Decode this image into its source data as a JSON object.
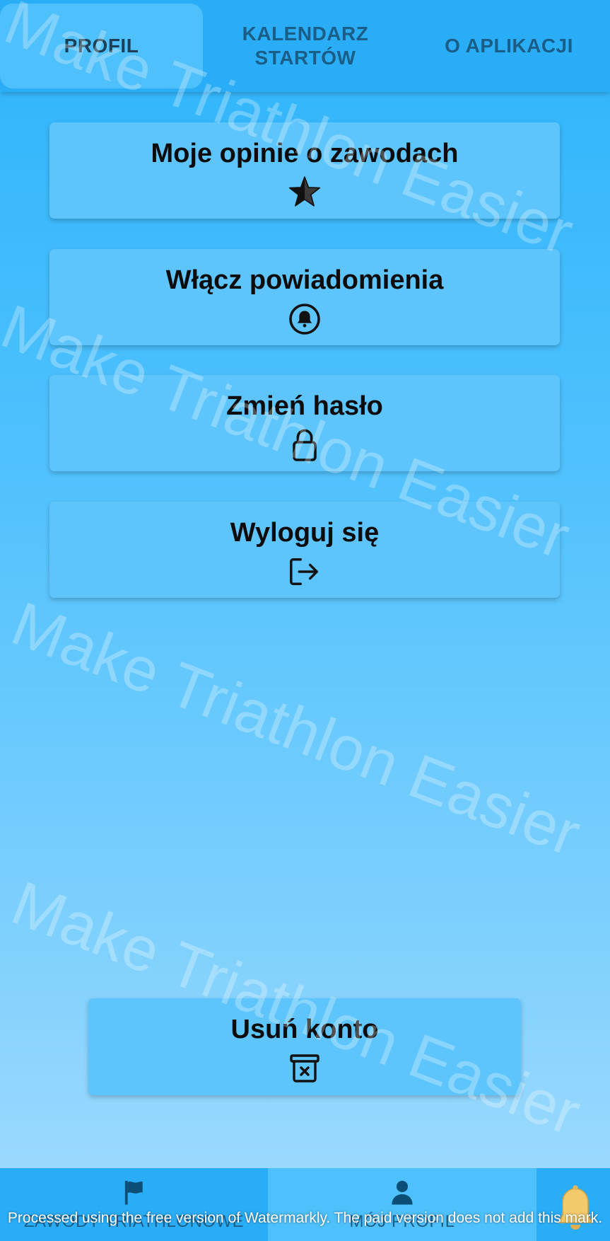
{
  "top_tabs": [
    {
      "label": "PROFIL",
      "active": true
    },
    {
      "label_line1": "KALENDARZ",
      "label_line2": "STARTÓW",
      "active": false
    },
    {
      "label": "O APLIKACJI",
      "active": false
    }
  ],
  "menu": {
    "opinions": {
      "label": "Moje opinie o zawodach",
      "icon": "star-half-icon"
    },
    "notifications": {
      "label": "Włącz powiadomienia",
      "icon": "bell-circle-icon"
    },
    "password": {
      "label": "Zmień hasło",
      "icon": "lock-icon"
    },
    "logout": {
      "label": "Wyloguj się",
      "icon": "logout-icon"
    },
    "delete_account": {
      "label": "Usuń konto",
      "icon": "trash-x-icon"
    }
  },
  "bottom_nav": [
    {
      "label": "ZAWODY TRIATHLONOWE",
      "icon": "flag-icon",
      "active": false
    },
    {
      "label": "MÓJ PROFIL",
      "icon": "user-icon",
      "active": true
    }
  ],
  "watermark": {
    "text": "Make Triathlon Easier",
    "notice": "Processed using the free version of Watermarkly. The paid version does not add this mark."
  },
  "colors": {
    "accent": "#2aadf7",
    "card": "#5dc5fc",
    "active_tab": "#4ec0fb",
    "tab_text": "#1a5d86",
    "bell": "#f2c96b"
  }
}
